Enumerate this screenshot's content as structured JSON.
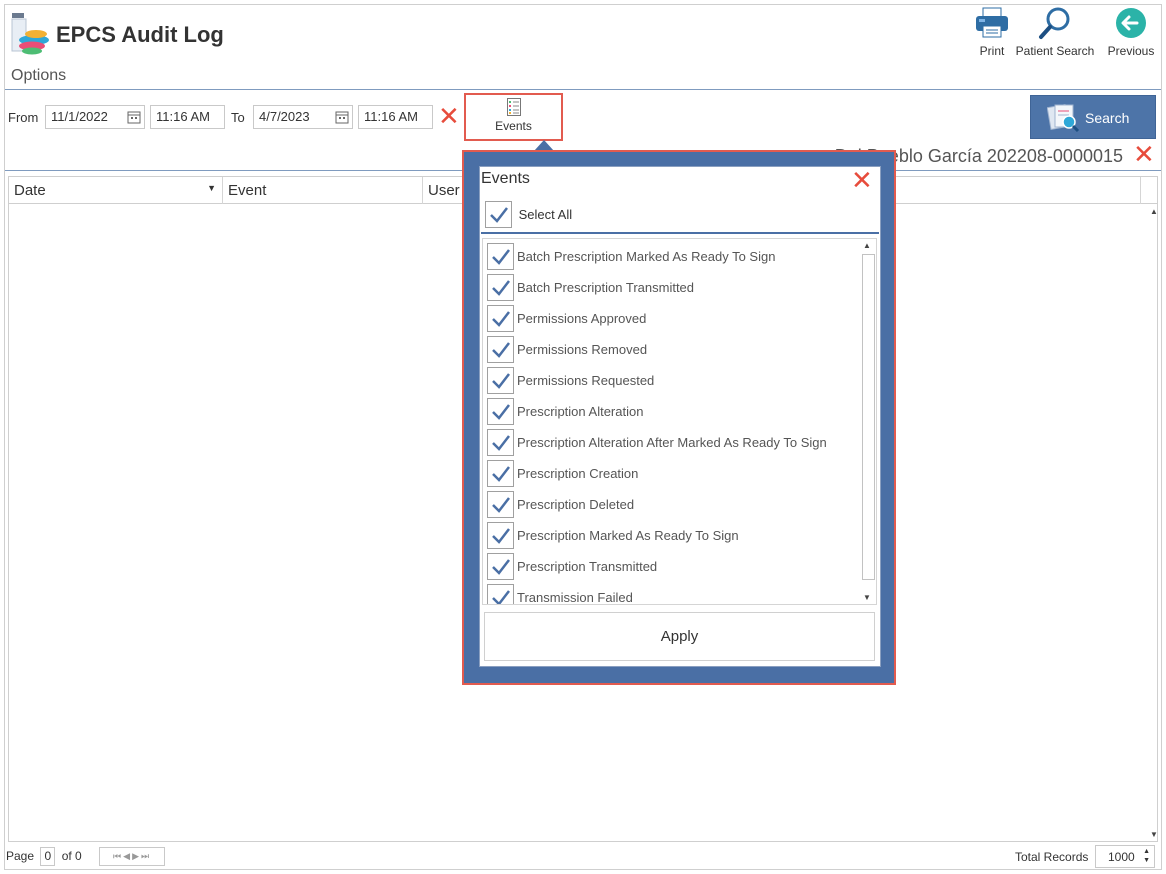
{
  "app": {
    "title": "EPCS Audit Log"
  },
  "header": {
    "options_label": "Options",
    "buttons": {
      "print": "Print",
      "patient_search": "Patient Search",
      "previous": "Previous"
    }
  },
  "filters": {
    "from_label": "From",
    "from_date": "11/1/2022",
    "from_time": "11:16 AM",
    "to_label": "To",
    "to_date": "4/7/2023",
    "to_time": "11:16 AM",
    "events_label": "Events",
    "search_label": "Search"
  },
  "patient": {
    "text": "Del Pueblo García 202208-0000015"
  },
  "grid": {
    "columns": [
      "Date",
      "Event",
      "User"
    ]
  },
  "footer": {
    "page_label": "Page",
    "page_value": "0",
    "of_label": "of 0",
    "total_label": "Total Records",
    "total_value": "1000"
  },
  "events_popup": {
    "title": "Events",
    "select_all": "Select All",
    "items": [
      "Batch Prescription Marked As Ready To Sign",
      "Batch Prescription Transmitted",
      "Permissions Approved",
      "Permissions Removed",
      "Permissions Requested",
      "Prescription Alteration",
      "Prescription Alteration After Marked As Ready To Sign",
      "Prescription Creation",
      "Prescription Deleted",
      "Prescription Marked As Ready To Sign",
      "Prescription Transmitted",
      "Transmission Failed"
    ],
    "apply_label": "Apply"
  },
  "colors": {
    "accent": "#4a6fa5",
    "highlight": "#e25b4f",
    "clear": "#e74c3c"
  }
}
